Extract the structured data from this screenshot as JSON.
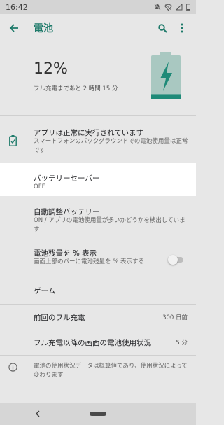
{
  "status_bar": {
    "time": "16:42"
  },
  "app_bar": {
    "title": "電池"
  },
  "hero": {
    "percent": "12%",
    "remaining": "フル充電まであと 2 時間 15 分",
    "battery_level": 0.12,
    "battery_color": "#1e8a78"
  },
  "tip": {
    "title": "アプリは正常に実行されています",
    "summary": "スマートフォンのバックグラウンドでの電池使用量は正常です"
  },
  "battery_saver": {
    "title": "バッテリーセーバー",
    "summary": "OFF"
  },
  "adaptive": {
    "title": "自動調整バッテリー",
    "summary": "ON / アプリの電池使用量が多いかどうかを検出しています"
  },
  "percentage": {
    "title": "電池残量を % 表示",
    "summary": "画面上部のバーに電池残量を % 表示する",
    "enabled": false
  },
  "game": {
    "title": "ゲーム"
  },
  "last_full_charge": {
    "title": "前回のフル充電",
    "value": "300 日前"
  },
  "screen_usage": {
    "title": "フル充電以降の画面の電池使用状況",
    "value": "5 分"
  },
  "info": {
    "text": "電池の使用状況データは概算値であり、使用状況によって変わります"
  },
  "colors": {
    "accent": "#1e7a6a",
    "background": "#e7e7e7",
    "highlight": "#ffffff"
  }
}
